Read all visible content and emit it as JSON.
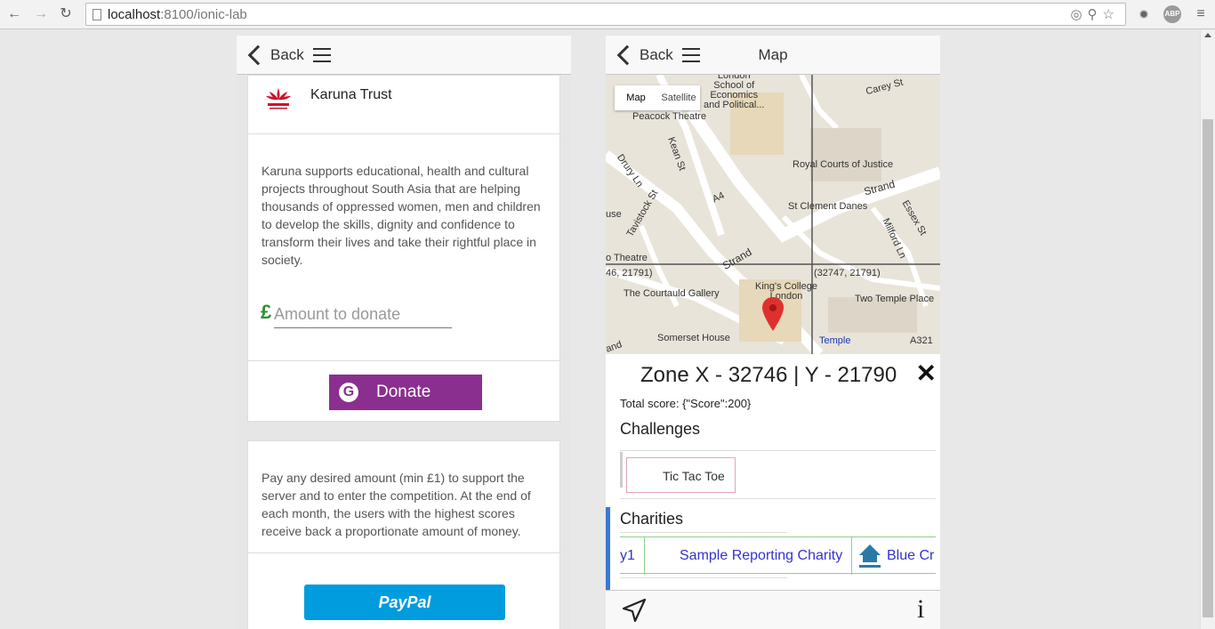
{
  "browser": {
    "url_host": "localhost",
    "url_path": ":8100/ionic-lab"
  },
  "left": {
    "back_label": "Back",
    "charity_name": "Karuna Trust",
    "description": "Karuna supports educational, health and cultural projects throughout South Asia that are helping thousands of oppressed women, men and children to develop the skills, dignity and confidence to transform their lives and take their rightful place in society.",
    "currency_symbol": "£",
    "amount_placeholder": "Amount to donate",
    "donate_label": "Donate",
    "pay_description": "Pay any desired amount (min £1) to support the server and to enter the competition. At the end of each month, the users with the highest scores receive back a proportionate amount of money.",
    "paypal_label": "PayPal"
  },
  "right": {
    "back_label": "Back",
    "title": "Map",
    "map": {
      "tabs": [
        "Map",
        "Satellite"
      ],
      "labels": {
        "london_school": "London\nSchool of\nEconomics\nand Political...",
        "peacock": "Peacock Theatre",
        "carey": "Carey St",
        "kean": "Kean St",
        "royal_courts": "Royal Courts of Justice",
        "drury": "Drury Ln",
        "strand1": "Strand",
        "a4": "A4",
        "tavistock": "Tavistock St",
        "st_clement": "St Clement Danes",
        "essex": "Essex St",
        "use": "use",
        "theatre": "o Theatre",
        "milford": "Milford Ln",
        "strand2": "Strand",
        "coord1": "46, 21791)",
        "coord2": "(32747, 21791)",
        "courtauld": "The Courtauld Gallery",
        "kings": "King's College\nLondon",
        "two_temple": "Two Temple Place",
        "and1": "and",
        "somerset": "Somerset House",
        "temple": "Temple",
        "a3211": "A321"
      }
    },
    "zone_title": "Zone X - 32746 | Y - 21790",
    "total_score": "Total score: {\"Score\":200}",
    "challenges_heading": "Challenges",
    "challenges": [
      "Tic Tac Toe"
    ],
    "charities_heading": "Charities",
    "charities": [
      "y1",
      "Sample Reporting Charity",
      "Blue Cr"
    ]
  }
}
